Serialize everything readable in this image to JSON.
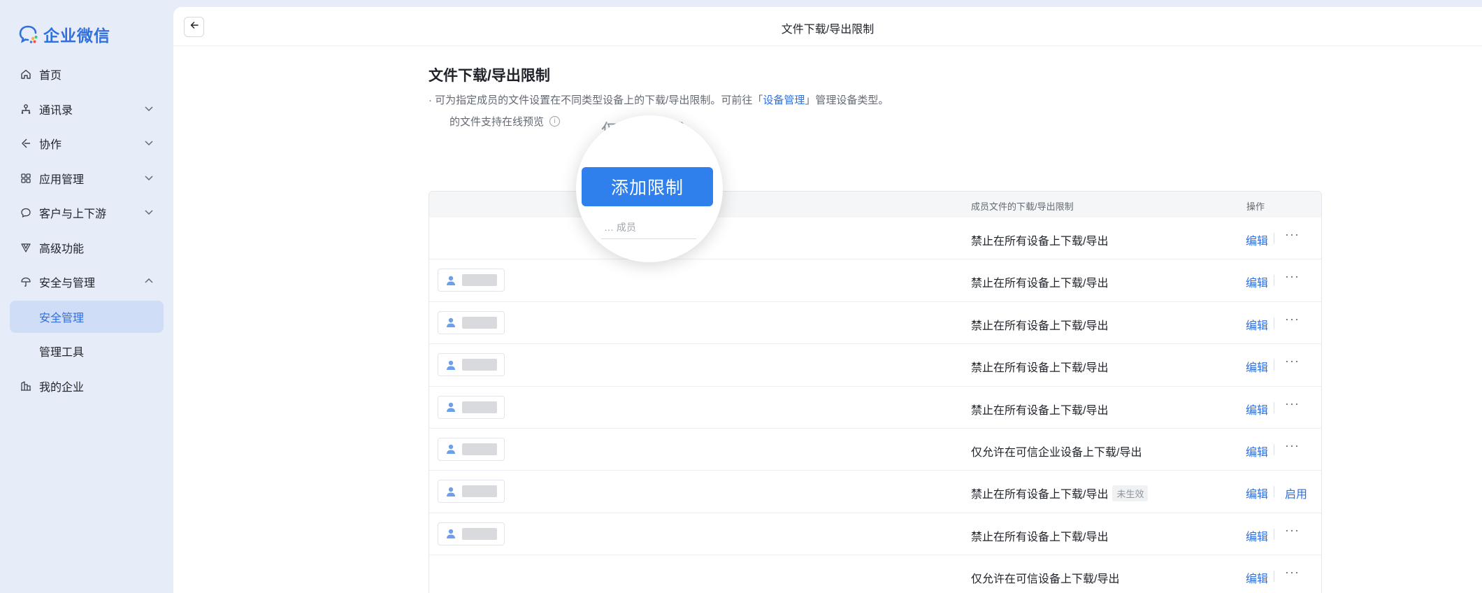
{
  "app": {
    "name": "企业微信",
    "accent": "#2f6fe0"
  },
  "sidebar": {
    "items": [
      {
        "label": "首页",
        "icon": "home-icon",
        "chevron": "none"
      },
      {
        "label": "通讯录",
        "icon": "org-chart-icon",
        "chevron": "down"
      },
      {
        "label": "协作",
        "icon": "collaboration-icon",
        "chevron": "down"
      },
      {
        "label": "应用管理",
        "icon": "apps-grid-icon",
        "chevron": "down"
      },
      {
        "label": "客户与上下游",
        "icon": "chat-bubble-icon",
        "chevron": "down"
      },
      {
        "label": "高级功能",
        "icon": "advanced-icon",
        "chevron": "none"
      },
      {
        "label": "安全与管理",
        "icon": "umbrella-icon",
        "chevron": "up"
      },
      {
        "label": "安全管理",
        "icon": "",
        "chevron": "none",
        "sub": true,
        "active": true
      },
      {
        "label": "管理工具",
        "icon": "",
        "chevron": "none",
        "sub": true
      },
      {
        "label": "我的企业",
        "icon": "building-icon",
        "chevron": "none"
      }
    ]
  },
  "header": {
    "title": "文件下载/导出限制"
  },
  "page": {
    "title": "文件下载/导出限制",
    "desc_prefix": "· 可为指定成员的文件设置在不同类型设备上的下载/导出限制。可前往「",
    "desc_link": "设备管理",
    "desc_suffix": "」管理设备类型。",
    "note_text": "的文件支持在线预览",
    "add_button": "添加限制",
    "magnified_text": "仅限制下载",
    "magnified_row_text": "… 成员"
  },
  "table": {
    "headers": {
      "limit": "成员文件的下载/导出限制",
      "ops": "操作"
    },
    "rows": [
      {
        "limit": "禁止在所有设备上下载/导出",
        "edit": "编辑",
        "more": "···",
        "member": false
      },
      {
        "limit": "禁止在所有设备上下载/导出",
        "edit": "编辑",
        "more": "···",
        "member": true
      },
      {
        "limit": "禁止在所有设备上下载/导出",
        "edit": "编辑",
        "more": "···",
        "member": true
      },
      {
        "limit": "禁止在所有设备上下载/导出",
        "edit": "编辑",
        "more": "···",
        "member": true
      },
      {
        "limit": "禁止在所有设备上下载/导出",
        "edit": "编辑",
        "more": "···",
        "member": true
      },
      {
        "limit": "仅允许在可信企业设备上下载/导出",
        "edit": "编辑",
        "more": "···",
        "member": true
      },
      {
        "limit": "禁止在所有设备上下载/导出",
        "badge": "未生效",
        "edit": "编辑",
        "enable": "启用",
        "member": true
      },
      {
        "limit": "禁止在所有设备上下载/导出",
        "edit": "编辑",
        "more": "···",
        "member": true
      },
      {
        "limit": "仅允许在可信设备上下载/导出",
        "edit": "编辑",
        "more": "···",
        "member": false
      }
    ]
  }
}
